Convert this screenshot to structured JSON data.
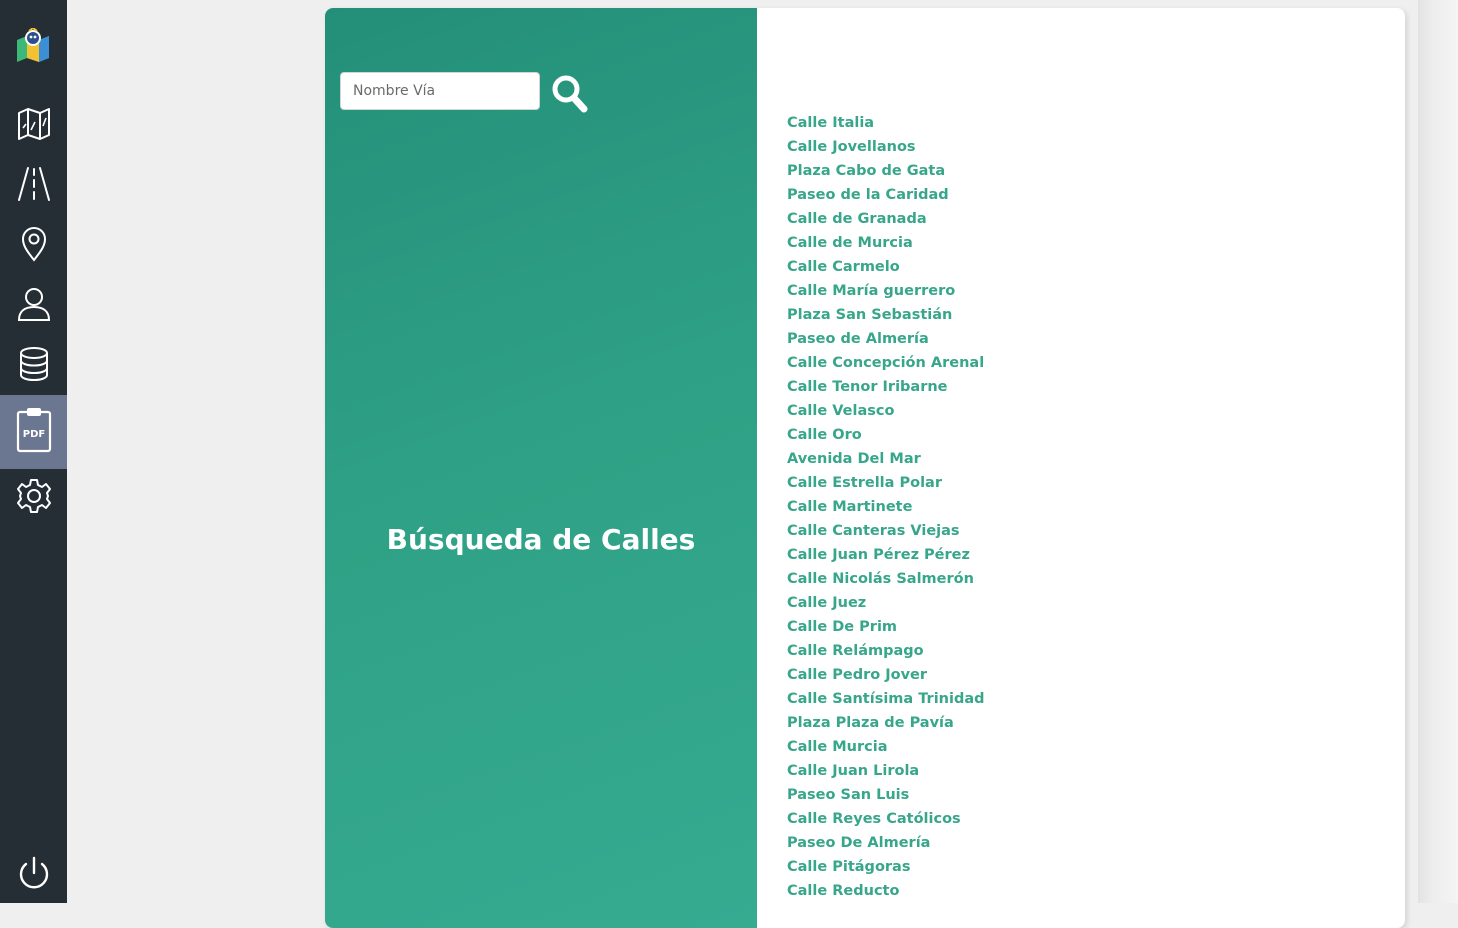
{
  "sidebar": {
    "items": [
      {
        "icon": "map-icon",
        "active": false
      },
      {
        "icon": "road-icon",
        "active": false
      },
      {
        "icon": "location-pin-icon",
        "active": false
      },
      {
        "icon": "user-icon",
        "active": false
      },
      {
        "icon": "database-icon",
        "active": false
      },
      {
        "icon": "pdf-clipboard-icon",
        "active": true,
        "badge": "PDF"
      },
      {
        "icon": "gear-icon",
        "active": false
      }
    ],
    "footer_icon": "power-icon"
  },
  "search": {
    "placeholder": "Nombre Vía",
    "value": ""
  },
  "panel": {
    "title": "Búsqueda de Calles"
  },
  "streets": [
    "Calle Italia",
    "Calle Jovellanos",
    "Plaza Cabo de Gata",
    "Paseo de la Caridad",
    "Calle de Granada",
    "Calle de Murcia",
    "Calle Carmelo",
    "Calle María guerrero",
    "Plaza San Sebastián",
    "Paseo de Almería",
    "Calle Concepción Arenal",
    "Calle Tenor Iribarne",
    "Calle Velasco",
    "Calle Oro",
    "Avenida Del Mar",
    "Calle Estrella Polar",
    "Calle Martinete",
    "Calle Canteras Viejas",
    "Calle Juan Pérez Pérez",
    "Calle Nicolás Salmerón",
    "Calle Juez",
    "Calle De Prim",
    "Calle Relámpago",
    "Calle Pedro Jover",
    "Calle Santísima Trinidad",
    "Plaza Plaza de Pavía",
    "Calle Murcia",
    "Calle Juan Lirola",
    "Paseo San Luis",
    "Calle Reyes Católicos",
    "Paseo De Almería",
    "Calle Pitágoras",
    "Calle Reducto"
  ],
  "colors": {
    "sidebar_bg": "#252e35",
    "sidebar_active": "#6b7790",
    "panel_green": "#2ea085",
    "link_green": "#37a68a"
  }
}
